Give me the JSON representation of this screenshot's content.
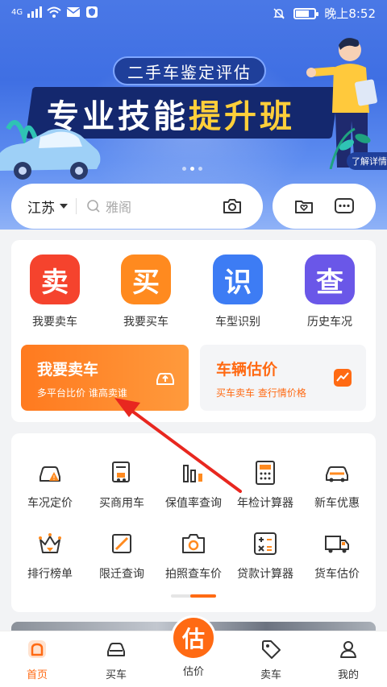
{
  "status_bar": {
    "network": "4G",
    "time": "晚上8:52"
  },
  "banner": {
    "subtitle": "二手车鉴定评估",
    "title_part1": "专业技能",
    "title_part2": "提升班",
    "detail_link": "了解详情"
  },
  "search": {
    "region": "江苏",
    "placeholder": "雅阁"
  },
  "quick_actions": [
    {
      "glyph": "卖",
      "label": "我要卖车",
      "color": "#f5432d"
    },
    {
      "glyph": "买",
      "label": "我要买车",
      "color": "#ff8a1f"
    },
    {
      "glyph": "识",
      "label": "车型识别",
      "color": "#3d7cf4"
    },
    {
      "glyph": "查",
      "label": "历史车况",
      "color": "#6a57e8"
    }
  ],
  "promos": {
    "sell": {
      "title": "我要卖车",
      "subtitle": "多平台比价 谁高卖谁"
    },
    "valuation": {
      "title": "车辆估价",
      "subtitle": "买车卖车 查行情价格"
    }
  },
  "tools": [
    {
      "label": "车况定价",
      "icon": "car-warning-icon"
    },
    {
      "label": "买商用车",
      "icon": "commercial-truck-icon"
    },
    {
      "label": "保值率查询",
      "icon": "bar-chart-icon"
    },
    {
      "label": "年检计算器",
      "icon": "calculator-icon"
    },
    {
      "label": "新车优惠",
      "icon": "new-car-icon"
    },
    {
      "label": "排行榜单",
      "icon": "crown-icon"
    },
    {
      "label": "限迁查询",
      "icon": "restriction-icon"
    },
    {
      "label": "拍照查车价",
      "icon": "camera-icon"
    },
    {
      "label": "贷款计算器",
      "icon": "loan-calculator-icon"
    },
    {
      "label": "货车估价",
      "icon": "truck-icon"
    }
  ],
  "tabs": {
    "home": "首页",
    "buy": "买车",
    "estimate_glyph": "估",
    "estimate": "估价",
    "sell": "卖车",
    "mine": "我的"
  },
  "colors": {
    "accent": "#ff6a13",
    "annotation_arrow": "#e8271f"
  }
}
